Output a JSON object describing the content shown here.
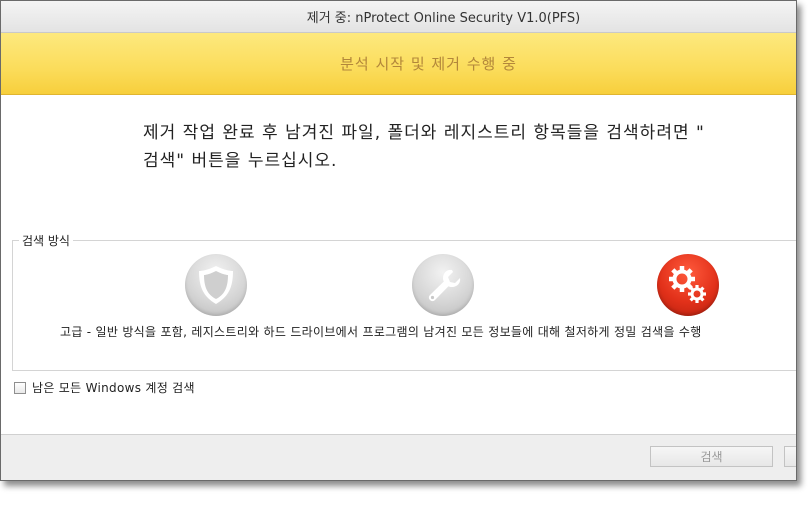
{
  "window": {
    "title": "제거 중: nProtect Online Security V1.0(PFS)"
  },
  "banner": {
    "text": "분석 시작 및 제거 수행 중"
  },
  "instruction": {
    "line1": "제거 작업 완료 후 남겨진 파일, 폴더와 레지스트리 항목들을 검색하려면 \"",
    "line2": "검색\" 버튼을 누르십시오."
  },
  "search_method": {
    "legend": "검색 방식",
    "options": [
      {
        "icon": "shield-icon"
      },
      {
        "icon": "wrench-icon"
      },
      {
        "icon": "gears-icon",
        "selected": true
      }
    ],
    "description": "고급 - 일반 방식을 포함, 레지스트리와 하드 드라이브에서 프로그램의 남겨진 모든 정보들에 대해 철저하게 정밀 검색을 수행"
  },
  "checkbox": {
    "label": "남은 모든 Windows 계정 검색",
    "checked": false
  },
  "footer": {
    "search_button_label": "검색"
  },
  "colors": {
    "banner": "#fbdc5a",
    "banner_text": "#b3873a",
    "selected_icon": "#e2311a"
  }
}
